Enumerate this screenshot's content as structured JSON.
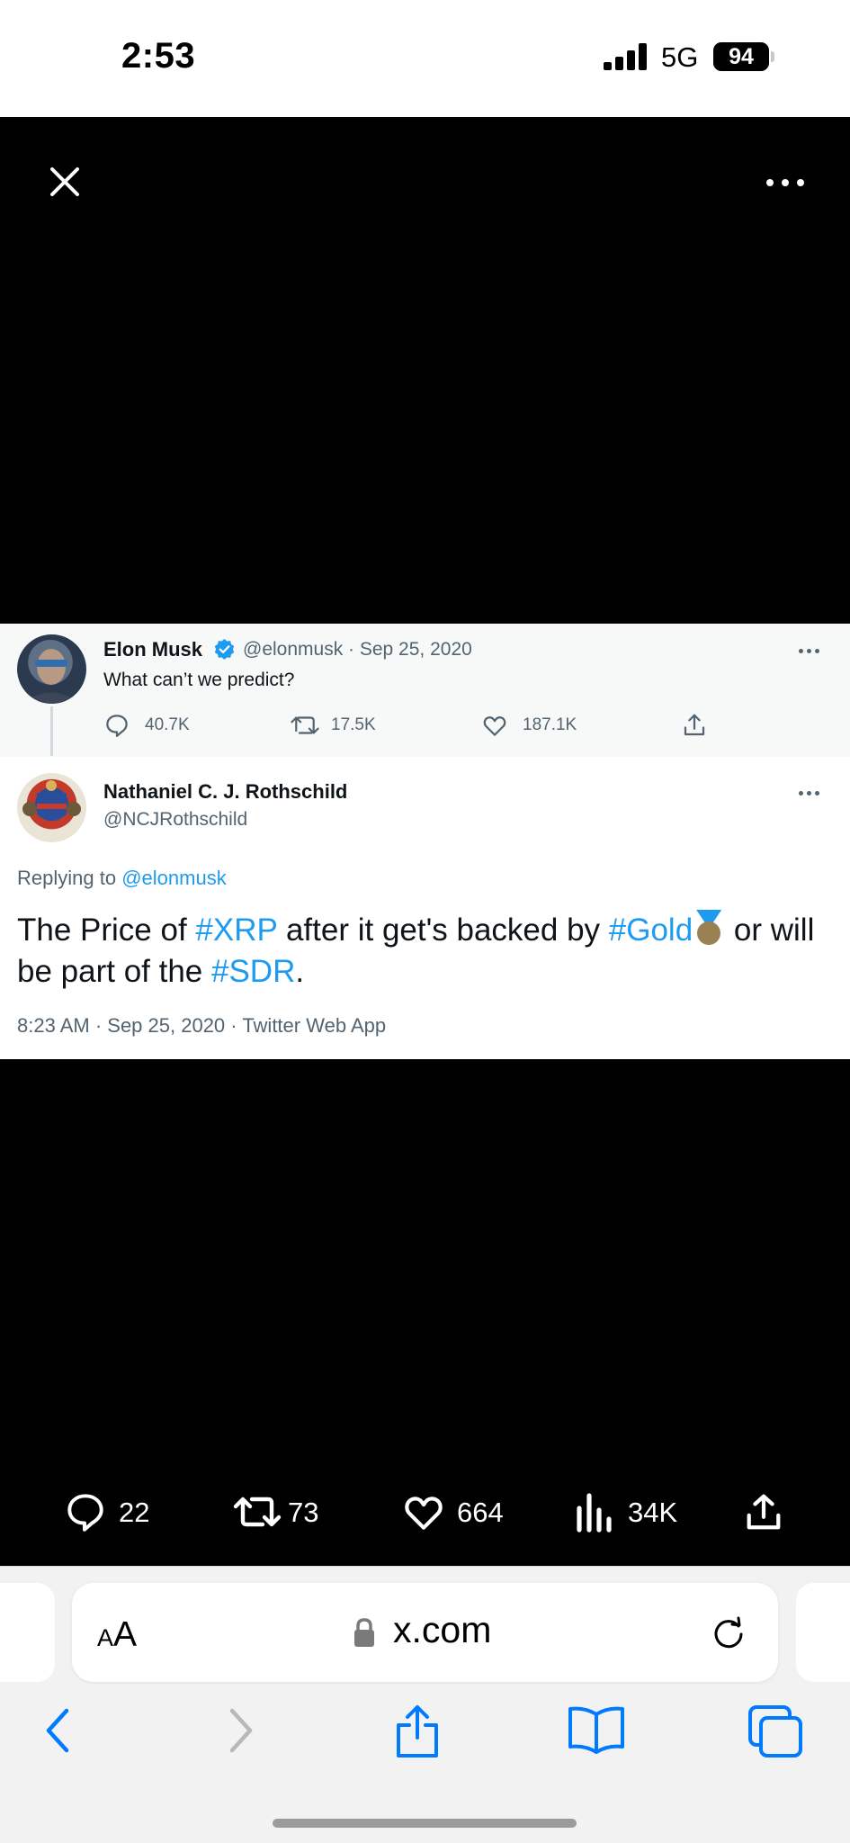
{
  "status_bar": {
    "time": "2:53",
    "network": "5G",
    "battery": "94"
  },
  "viewer": {
    "close_icon": "close-icon",
    "more_icon": "more-icon"
  },
  "shot": {
    "original_tweet": {
      "author_name": "Elon Musk",
      "meta": "@elonmusk · Sep 25, 2020",
      "text": "What can’t we predict?",
      "actions": {
        "replies": "40.7K",
        "retweets": "17.5K",
        "likes": "187.1K"
      }
    },
    "reply_tweet": {
      "author_name": "Nathaniel C. J. Rothschild",
      "handle": "@NCJRothschild",
      "replying_prefix": "Replying to",
      "replying_to": "@elonmusk",
      "body": {
        "t1": "The Price of ",
        "tag_xrp": "#XRP",
        "t2": " after it get's backed by ",
        "tag_gold": "#Gold",
        "t3": " or will be part of the ",
        "tag_sdr": "#SDR",
        "t4": "."
      },
      "timestamp": "8:23 AM · Sep 25, 2020 · Twitter Web App"
    }
  },
  "tweet_actions": {
    "replies": "22",
    "reposts": "73",
    "likes": "664",
    "views": "34K"
  },
  "browser": {
    "text_size_small": "A",
    "text_size_large": "A",
    "url": "x.com"
  },
  "colors": {
    "link": "#1d9bf0",
    "secondary_text": "#536471",
    "viewer_bg": "#000000",
    "toolbar_blue": "#007aff"
  }
}
